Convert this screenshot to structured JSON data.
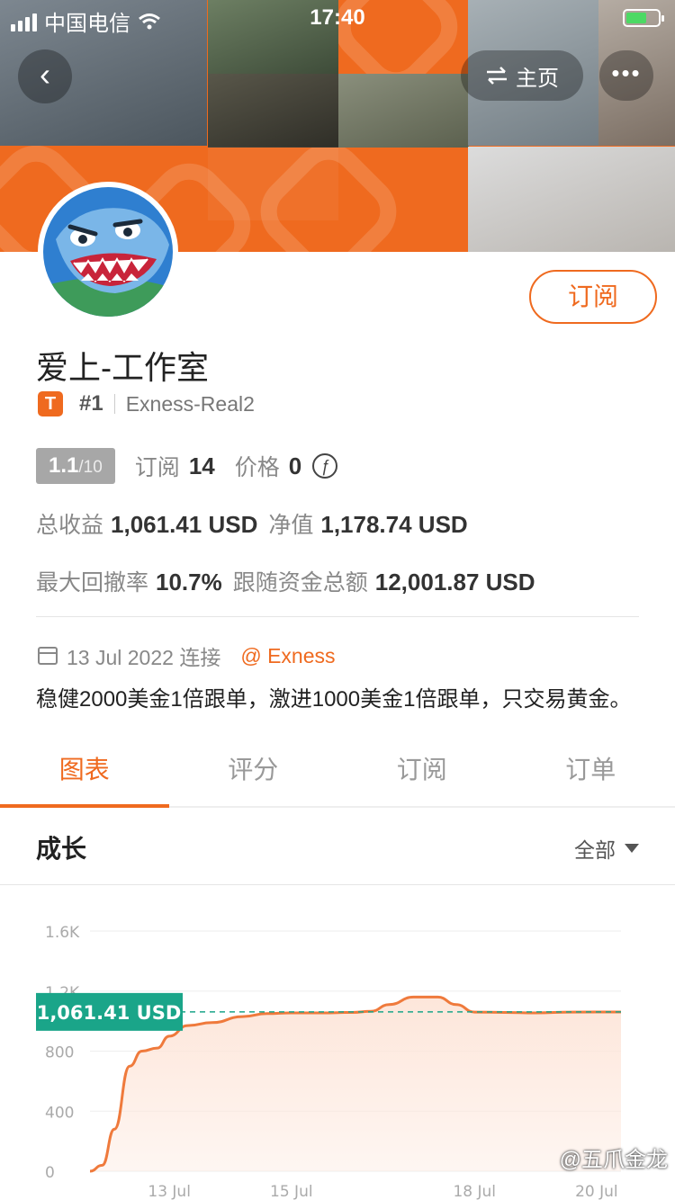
{
  "status_bar": {
    "carrier": "中国电信",
    "time": "17:40"
  },
  "header": {
    "home_label": "主页",
    "more_label": "•••"
  },
  "profile": {
    "subscribe_label": "订阅",
    "name": "爱上-工作室",
    "badge": "T",
    "rank": "#1",
    "server": "Exness-Real2"
  },
  "stats": {
    "score": "1.1",
    "score_max": "/10",
    "subscriptions_label": "订阅",
    "subscriptions": "14",
    "price_label": "价格",
    "price": "0",
    "total_profit_label": "总收益",
    "total_profit": "1,061.41 USD",
    "equity_label": "净值",
    "equity": "1,178.74 USD",
    "max_drawdown_label": "最大回撤率",
    "max_drawdown": "10.7%",
    "follow_total_label": "跟随资金总额",
    "follow_total": "12,001.87 USD"
  },
  "meta": {
    "connected": "13 Jul 2022 连接",
    "broker": "@ Exness"
  },
  "description": "稳健2000美金1倍跟单，激进1000美金1倍跟单，只交易黄金。",
  "tabs": [
    {
      "label": "图表",
      "active": true
    },
    {
      "label": "评分",
      "active": false
    },
    {
      "label": "订阅",
      "active": false
    },
    {
      "label": "订单",
      "active": false
    }
  ],
  "section": {
    "title": "成长",
    "filter": "全部"
  },
  "chart_data": {
    "type": "area",
    "y_ticks": [
      "0",
      "400",
      "800",
      "1.2K",
      "1.6K"
    ],
    "ylim": [
      0,
      1600
    ],
    "x_ticks": [
      {
        "day": 13,
        "label": "13 Jul"
      },
      {
        "day": 15,
        "label": "15 Jul"
      },
      {
        "day": 18,
        "label": "18 Jul"
      },
      {
        "day": 20,
        "label": "20 Jul"
      }
    ],
    "x_range_days": [
      11.7,
      20.4
    ],
    "series": [
      {
        "points": [
          [
            11.7,
            0
          ],
          [
            11.9,
            40
          ],
          [
            12.1,
            280
          ],
          [
            12.35,
            700
          ],
          [
            12.55,
            800
          ],
          [
            12.8,
            820
          ],
          [
            13.0,
            900
          ],
          [
            13.3,
            970
          ],
          [
            13.7,
            990
          ],
          [
            14.2,
            1030
          ],
          [
            14.6,
            1050
          ],
          [
            15.0,
            1055
          ],
          [
            15.5,
            1055
          ],
          [
            16.0,
            1058
          ],
          [
            16.3,
            1065
          ],
          [
            16.6,
            1110
          ],
          [
            17.0,
            1160
          ],
          [
            17.4,
            1160
          ],
          [
            17.7,
            1110
          ],
          [
            18.0,
            1060
          ],
          [
            18.5,
            1058
          ],
          [
            19.0,
            1055
          ],
          [
            19.6,
            1060
          ],
          [
            20.4,
            1061
          ]
        ]
      }
    ],
    "current_value": 1061.41,
    "current_label": "1,061.41 USD",
    "line_color": "#ef7a3c",
    "fill_color": "#fde6da",
    "marker_color": "#1aa589"
  },
  "watermark": "@五爪金龙"
}
